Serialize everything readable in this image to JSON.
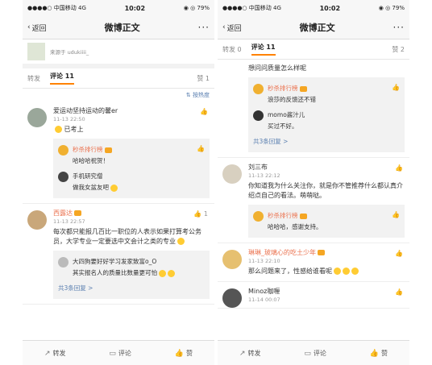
{
  "status": {
    "carrier": "●●●●○ 中国移动 4G",
    "time": "10:02",
    "battery": "◉ ◎ 79%"
  },
  "nav": {
    "back": "返回",
    "title": "微博正文",
    "more": "···"
  },
  "left": {
    "original_source": "来源于 udukiiii_",
    "tabs": {
      "repost": "转发",
      "comment": "评论 11",
      "like": "赞 1"
    },
    "sort": "按热度",
    "comments": [
      {
        "name": "爱运动坚持运动的馨er",
        "time": "11-13 22:50",
        "text": "已考上",
        "like": ""
      },
      {
        "name": "西露达",
        "time": "11-13 22:57",
        "text": "每次都只能报几百比一职位的人表示如果打算考公务员，大学专业一定要选中文会计之类的专业",
        "like": "1"
      }
    ],
    "replies1": [
      {
        "name": "秒杀排行榜",
        "text": "哈哈哈祝贺！"
      },
      {
        "name": "手机研究僧",
        "text": "做我女盆友吧"
      }
    ],
    "replies2": [
      {
        "name": "大四狗要好好学习发家致富o_O",
        "text": "其实报名人的质量比数量更可怕"
      }
    ],
    "more_replies": "共3条回复 >"
  },
  "right": {
    "tabs": {
      "repost": "转发 0",
      "comment": "评论 11",
      "like": "赞 2"
    },
    "top_text": "想问问质量怎么样呢",
    "replies1": [
      {
        "name": "秒杀排行榜",
        "text": "浪莎的反馈还不错"
      },
      {
        "name": "momo酱汁儿",
        "text": "买过不好。"
      }
    ],
    "more_replies": "共3条回复 >",
    "comments": [
      {
        "name": "刘三布",
        "time": "11-13 22:12",
        "text": "你知道我为什么关注你，就是你不管推荐什么都认真介绍点自己的看法。萌萌哒。"
      },
      {
        "name": "琳琳_玻璃心的吃土少年",
        "time": "11-13 22:10",
        "text": "那么问题来了，性感给谁看呢"
      },
      {
        "name": "Minoz咖喱",
        "time": "11-14 00:07",
        "text": ""
      }
    ],
    "replies2": [
      {
        "name": "秒杀排行榜",
        "text": "哈哈哈，感谢支持。"
      }
    ]
  },
  "bottom": {
    "repost": "转发",
    "comment": "评论",
    "like": "赞"
  }
}
